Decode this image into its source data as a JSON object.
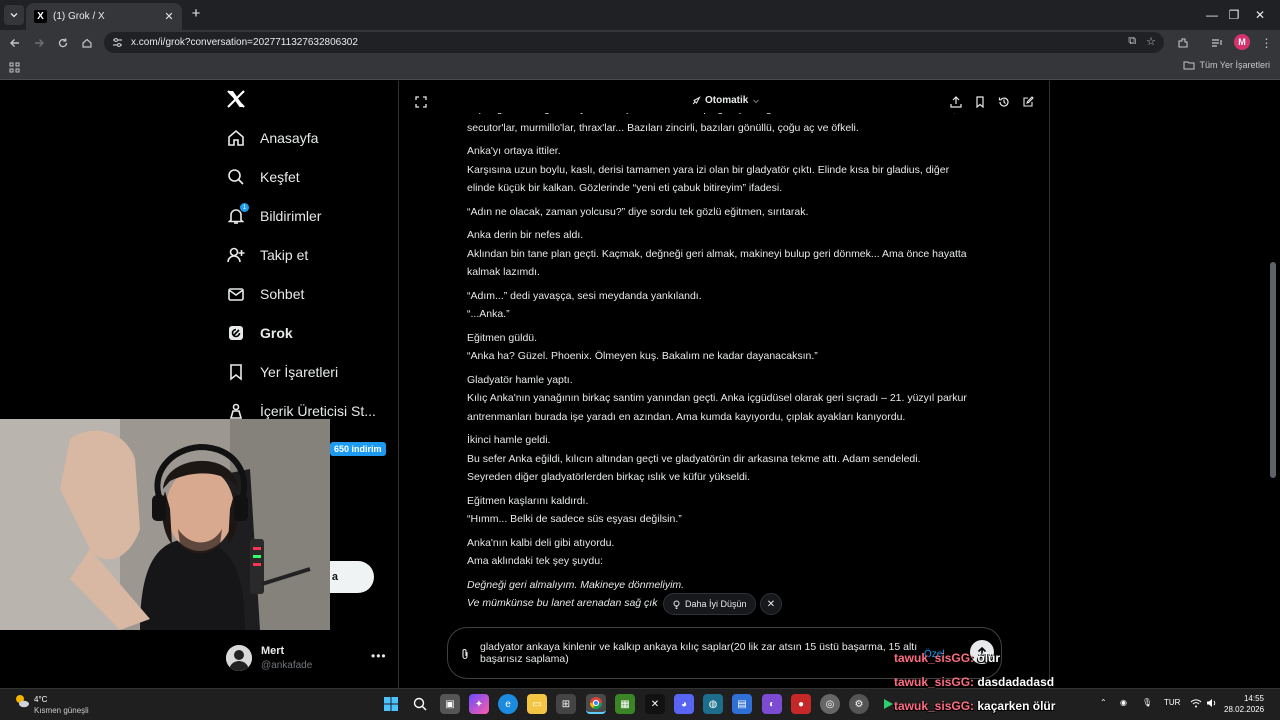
{
  "browser": {
    "tab_title": "(1) Grok / X",
    "url": "x.com/i/grok?conversation=2027711327632806302",
    "bookmarks_all": "Tüm Yer İşaretleri",
    "profile_initial": "M"
  },
  "sidebar": {
    "items": [
      {
        "label": "Anasayfa",
        "icon": "home-icon"
      },
      {
        "label": "Keşfet",
        "icon": "search-icon"
      },
      {
        "label": "Bildirimler",
        "icon": "bell-icon",
        "badge": "1"
      },
      {
        "label": "Takip et",
        "icon": "person-add-icon"
      },
      {
        "label": "Sohbet",
        "icon": "envelope-icon"
      },
      {
        "label": "Grok",
        "icon": "grok-icon"
      },
      {
        "label": "Yer İşaretleri",
        "icon": "bookmark-icon"
      },
      {
        "label": "İçerik Üreticisi St...",
        "icon": "creator-icon"
      }
    ],
    "promo_badge": "650 indirim",
    "post_button": "a",
    "profile": {
      "name": "Mert",
      "handle": "@ankafade"
    }
  },
  "grok": {
    "mode": "Otomatik",
    "paragraphs": [
      [
        "at pisliği kokusu genzini yaktı. Karşısında kumla kaplı geniş bir eğitim avlusu. Yüzlerce adam: retiarius'lar,",
        "secutor'lar, murmillo'lar, thrax'lar... Bazıları zincirli, bazıları gönüllü, çoğu aç ve öfkeli."
      ],
      [
        "Anka'yı ortaya ittiler.",
        "Karşısına uzun boylu, kaslı, derisi tamamen yara izi olan bir gladyatör çıktı. Elinde kısa bir gladius, diğer",
        "elinde küçük bir kalkan. Gözlerinde “yeni eti çabuk bitireyim” ifadesi."
      ],
      [
        "“Adın ne olacak, zaman yolcusu?” diye sordu tek gözlü eğitmen, sırıtarak."
      ],
      [
        "Anka derin bir nefes aldı.",
        "Aklından bin tane plan geçti. Kaçmak, değneği geri almak, makineyi bulup geri dönmek... Ama önce hayatta",
        "kalmak lazımdı."
      ],
      [
        "“Adım...” dedi yavaşça, sesi meydanda yankılandı.",
        "“...Anka.”"
      ],
      [
        "Eğitmen güldü.",
        "“Anka ha? Güzel. Phoenix. Ölmeyen kuş. Bakalım ne kadar dayanacaksın.”"
      ],
      [
        "Gladyatör hamle yaptı.",
        "Kılıç Anka'nın yanağının birkaç santim yanından geçti. Anka içgüdüsel olarak geri sıçradı – 21. yüzyıl parkur",
        "antrenmanları burada işe yaradı en azından. Ama kumda kayıyordu, çıplak ayakları kanıyordu."
      ],
      [
        "İkinci hamle geldi.",
        "Bu sefer Anka eğildi, kılıcın altından geçti ve gladyatörün dir arkasına tekme attı. Adam sendeledi.",
        "Seyreden diğer gladyatörlerden birkaç ıslık ve küfür yükseldi."
      ],
      [
        "Eğitmen kaşlarını kaldırdı.",
        "“Hımm... Belki de sadece süs eşyası değilsin.”"
      ],
      [
        "Anka'nın kalbi deli gibi atıyordu.",
        "Ama aklındaki tek şey şuydu:"
      ]
    ],
    "italic_lines": [
      "Değneği geri almalıyım. Makineye dönmeliyim.",
      "Ve mümkünse bu lanet arenadan sağ çık"
    ],
    "suggestion": "Daha İyi Düşün",
    "input_text": "gladyator ankaya kinlenir ve kalkıp ankaya kılıç saplar(20 lik zar atsın 15 üstü başarma, 15 altı başarısız saplama)",
    "ozel_label": "Özel"
  },
  "stream_chat": [
    {
      "user": "tawuk_sisGG:",
      "msg": "ölür"
    },
    {
      "user": "tawuk_sisGG:",
      "msg": "dasdadadasd"
    },
    {
      "user": "tawuk_sisGG:",
      "msg": "kaçarken ölür"
    }
  ],
  "taskbar": {
    "temp": "4°C",
    "weather": "Kısmen güneşli",
    "lang": "TUR",
    "time": "14:55",
    "date": "28.02.2026"
  }
}
